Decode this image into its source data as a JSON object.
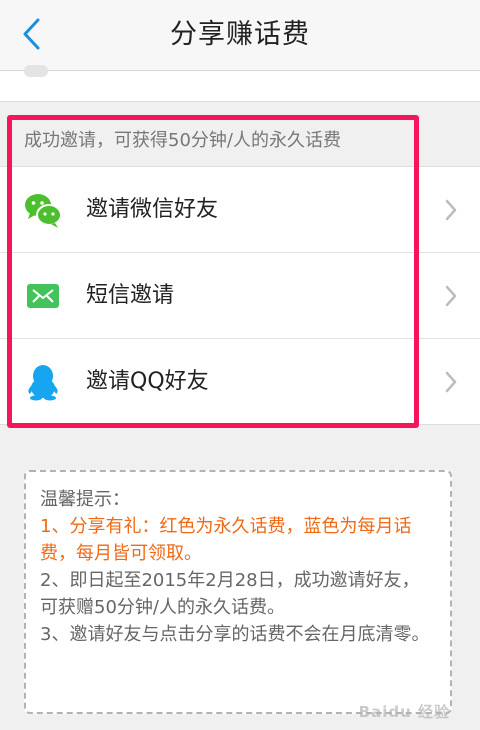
{
  "header": {
    "title": "分享赚话费"
  },
  "invite": {
    "note": "成功邀请，可获得50分钟/人的永久话费",
    "items": [
      {
        "label": "邀请微信好友",
        "icon": "wechat-icon"
      },
      {
        "label": "短信邀请",
        "icon": "sms-icon"
      },
      {
        "label": "邀请QQ好友",
        "icon": "qq-icon"
      }
    ]
  },
  "tips": {
    "title": "温馨提示：",
    "line1": "1、分享有礼：红色为永久话费，蓝色为每月话费，每月皆可领取。",
    "line2": "2、即日起至2015年2月28日，成功邀请好友，可获赠50分钟/人的永久话费。",
    "line3": "3、邀请好友与点击分享的话费不会在月底清零。"
  },
  "colors": {
    "accent_blue": "#1a8fe0",
    "highlight": "#f4155b",
    "wechat_green": "#4cbf2e",
    "sms_green": "#43c45a",
    "qq_blue": "#18a5f0",
    "tip_orange": "#ef6a16"
  },
  "watermark": "Baidu 经验"
}
